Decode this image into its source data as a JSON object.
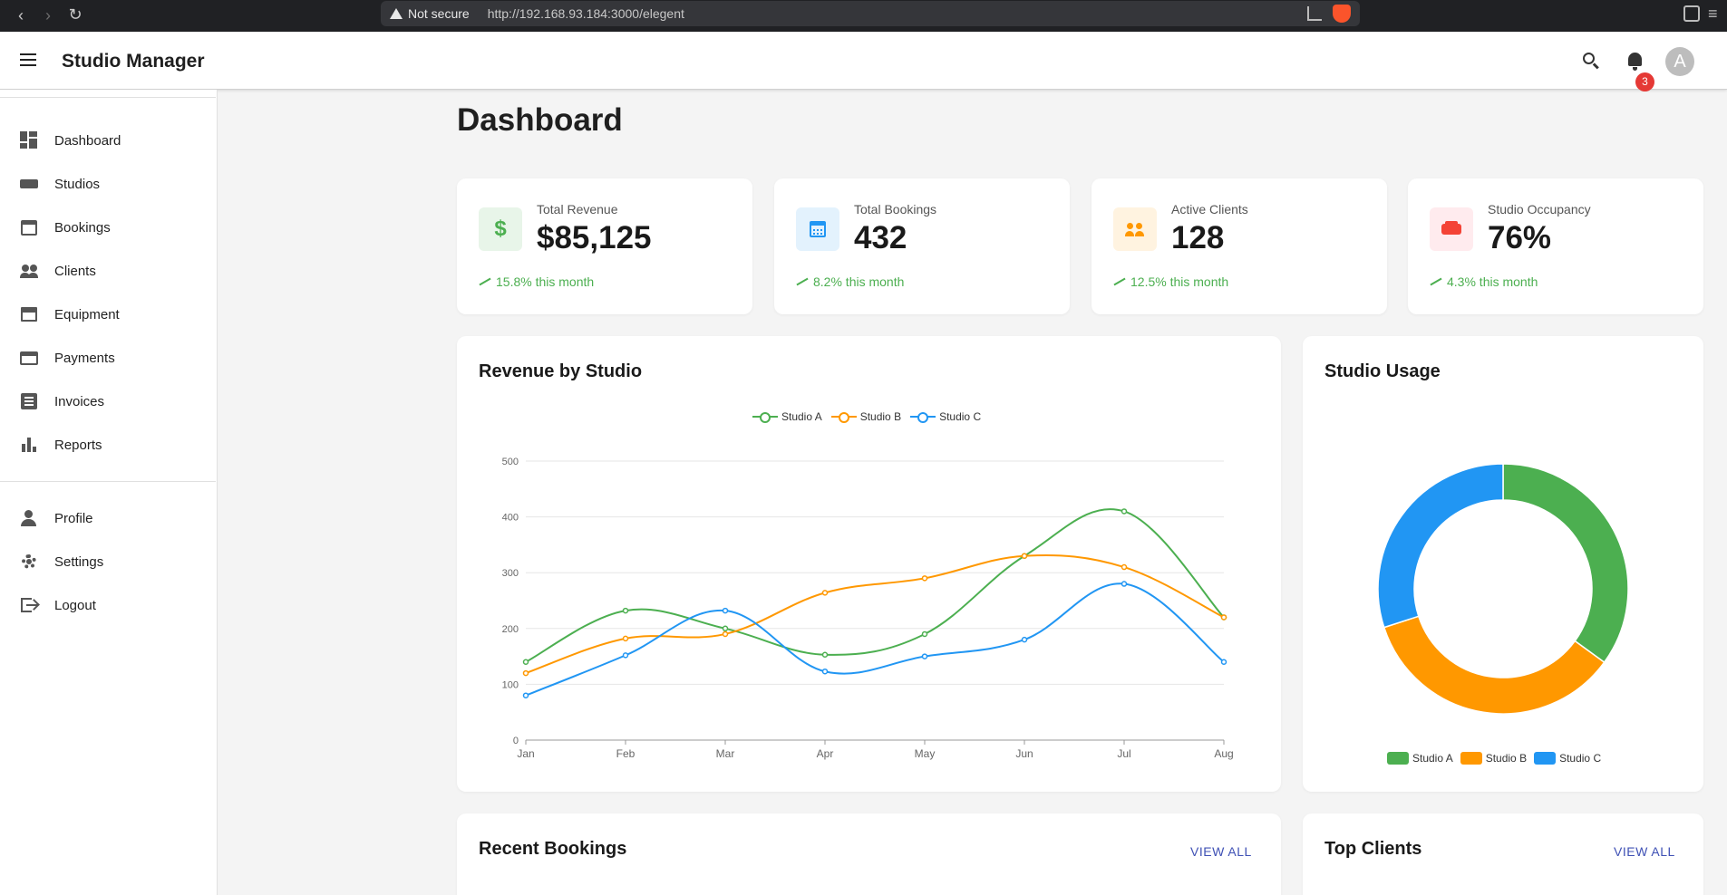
{
  "browser": {
    "security_label": "Not secure",
    "url": "http://192.168.93.184:3000/elegent"
  },
  "appbar": {
    "title": "Studio Manager",
    "notification_count": "3",
    "avatar_letter": "A"
  },
  "sidebar": {
    "items": [
      {
        "label": "Dashboard",
        "icon": "dashboard-icon"
      },
      {
        "label": "Studios",
        "icon": "sofa-icon"
      },
      {
        "label": "Bookings",
        "icon": "calendar-icon"
      },
      {
        "label": "Clients",
        "icon": "people-icon"
      },
      {
        "label": "Equipment",
        "icon": "archive-icon"
      },
      {
        "label": "Payments",
        "icon": "credit-card-icon"
      },
      {
        "label": "Invoices",
        "icon": "receipt-icon"
      },
      {
        "label": "Reports",
        "icon": "bar-chart-icon"
      }
    ],
    "account_items": [
      {
        "label": "Profile",
        "icon": "person-icon"
      },
      {
        "label": "Settings",
        "icon": "gear-icon"
      },
      {
        "label": "Logout",
        "icon": "logout-icon"
      }
    ]
  },
  "page": {
    "title": "Dashboard"
  },
  "stats": [
    {
      "label": "Total Revenue",
      "value": "$85,125",
      "trend": "15.8% this month",
      "icon": "dollar-icon",
      "color": "#4caf50",
      "bg": "#e8f5e9"
    },
    {
      "label": "Total Bookings",
      "value": "432",
      "trend": "8.2% this month",
      "icon": "calendar-icon",
      "color": "#2196f3",
      "bg": "#e3f2fd"
    },
    {
      "label": "Active Clients",
      "value": "128",
      "trend": "12.5% this month",
      "icon": "people-icon",
      "color": "#ff9800",
      "bg": "#fff3e0"
    },
    {
      "label": "Studio Occupancy",
      "value": "76%",
      "trend": "4.3% this month",
      "icon": "sofa-icon",
      "color": "#f44336",
      "bg": "#ffebee"
    }
  ],
  "revenue_card": {
    "title": "Revenue by Studio"
  },
  "usage_card": {
    "title": "Studio Usage"
  },
  "recent_bookings": {
    "title": "Recent Bookings",
    "action": "VIEW ALL"
  },
  "top_clients": {
    "title": "Top Clients",
    "action": "VIEW ALL"
  },
  "chart_data": [
    {
      "type": "line",
      "title": "Revenue by Studio",
      "x": [
        "Jan",
        "Feb",
        "Mar",
        "Apr",
        "May",
        "Jun",
        "Jul",
        "Aug"
      ],
      "ylim": [
        0,
        500
      ],
      "yticks": [
        0,
        100,
        200,
        300,
        400,
        500
      ],
      "grid": true,
      "legend": "top-center",
      "series": [
        {
          "name": "Studio A",
          "color": "#4caf50",
          "values": [
            140,
            232,
            200,
            153,
            190,
            330,
            410,
            220
          ]
        },
        {
          "name": "Studio B",
          "color": "#ff9800",
          "values": [
            120,
            182,
            190,
            264,
            290,
            330,
            310,
            220
          ]
        },
        {
          "name": "Studio C",
          "color": "#2196f3",
          "values": [
            80,
            152,
            232,
            123,
            150,
            180,
            280,
            140
          ]
        }
      ]
    },
    {
      "type": "pie",
      "title": "Studio Usage",
      "donut": true,
      "legend": "bottom",
      "categories": [
        "Studio A",
        "Studio B",
        "Studio C"
      ],
      "colors": [
        "#4caf50",
        "#ff9800",
        "#2196f3"
      ],
      "values": [
        35,
        35,
        30
      ]
    }
  ]
}
